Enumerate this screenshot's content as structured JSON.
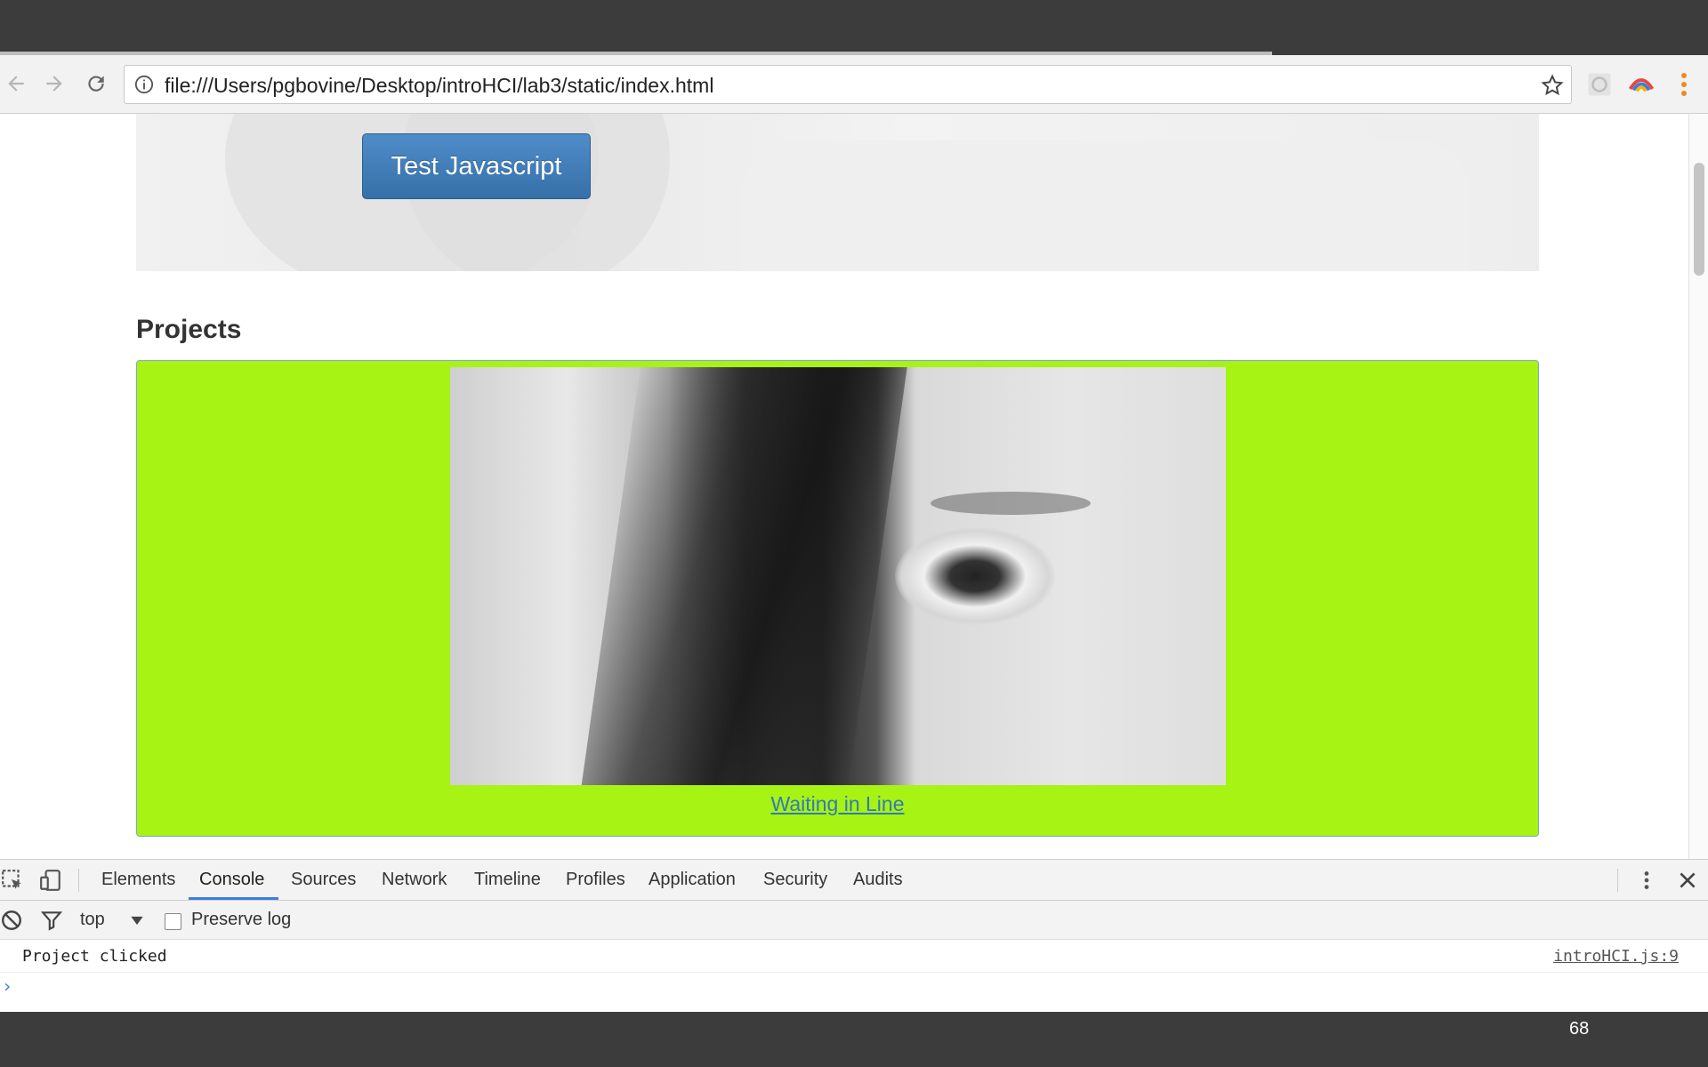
{
  "browser": {
    "url": "file:///Users/pgbovine/Desktop/introHCI/lab3/static/index.html"
  },
  "page": {
    "test_button_label": "Test Javascript",
    "section_title": "Projects",
    "project_link": "Waiting in Line",
    "project_card_color": "#a6f314"
  },
  "devtools": {
    "tabs": [
      "Elements",
      "Console",
      "Sources",
      "Network",
      "Timeline",
      "Profiles",
      "Application",
      "Security",
      "Audits"
    ],
    "active_tab": "Console",
    "context": "top",
    "preserve_log_label": "Preserve log",
    "preserve_log_checked": false,
    "console_message": "Project clicked",
    "console_source": "introHCI.js:9"
  },
  "slide": {
    "page_number": "68"
  }
}
